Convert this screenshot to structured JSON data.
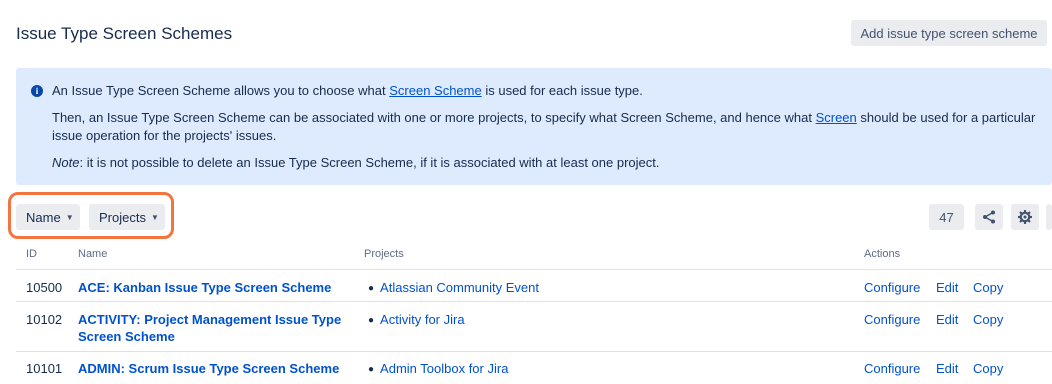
{
  "page": {
    "title": "Issue Type Screen Schemes",
    "add_button": "Add issue type screen scheme"
  },
  "info": {
    "line1_before": "An Issue Type Screen Scheme allows you to choose what ",
    "line1_link": "Screen Scheme",
    "line1_after": " is used for each issue type.",
    "line2_before": "Then, an Issue Type Screen Scheme can be associated with one or more projects, to specify what Screen Scheme, and hence what ",
    "line2_link": "Screen",
    "line2_after": " should be used for a particular issue operation for the projects' issues.",
    "line3_em": "Note",
    "line3_after": ": it is not possible to delete an Issue Type Screen Scheme, if it is associated with at least one project."
  },
  "filters": {
    "name_label": "Name",
    "projects_label": "Projects"
  },
  "toolbar": {
    "count": "47",
    "share_icon": "share-icon",
    "gear_icon": "gear-icon"
  },
  "table": {
    "headers": {
      "id": "ID",
      "name": "Name",
      "projects": "Projects",
      "actions": "Actions"
    },
    "rows": [
      {
        "id": "10500",
        "name": "ACE: Kanban Issue Type Screen Scheme",
        "project": "Atlassian Community Event",
        "configure": "Configure",
        "edit": "Edit",
        "copy": "Copy"
      },
      {
        "id": "10102",
        "name": "ACTIVITY: Project Management Issue Type Screen Scheme",
        "project": "Activity for Jira",
        "configure": "Configure",
        "edit": "Edit",
        "copy": "Copy"
      },
      {
        "id": "10101",
        "name": "ADMIN: Scrum Issue Type Screen Scheme",
        "project": "Admin Toolbox for Jira",
        "configure": "Configure",
        "edit": "Edit",
        "copy": "Copy"
      }
    ]
  },
  "colors": {
    "link": "#0052cc",
    "info_bg": "#deebff",
    "highlight": "#f4743f",
    "button_bg": "#ebecf0"
  }
}
